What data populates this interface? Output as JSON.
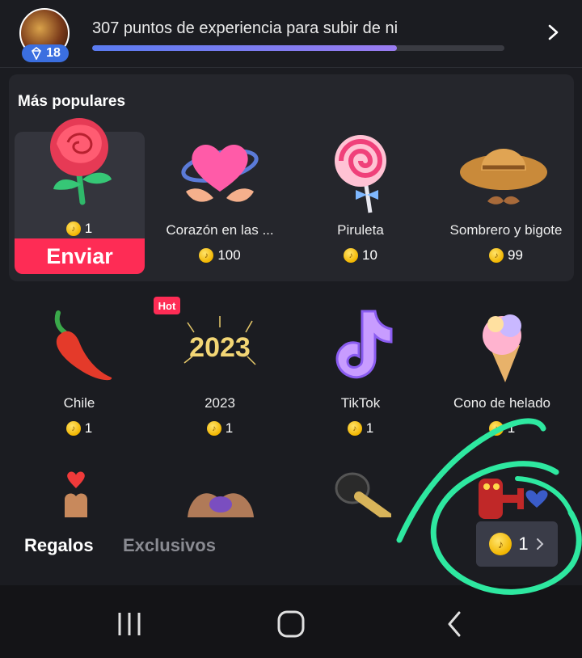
{
  "header": {
    "level": "18",
    "xp_text": "307 puntos de experiencia para subir de ni",
    "xp_progress": 0.74
  },
  "popular": {
    "title": "Más populares",
    "send_label": "Enviar",
    "items": [
      {
        "name": "",
        "price": "1",
        "icon": "rose-icon"
      },
      {
        "name": "Corazón en las ...",
        "price": "100",
        "icon": "heart-hands-icon"
      },
      {
        "name": "Piruleta",
        "price": "10",
        "icon": "lollipop-icon"
      },
      {
        "name": "Sombrero y bigote",
        "price": "99",
        "icon": "hat-mustache-icon"
      }
    ]
  },
  "gifts": [
    {
      "name": "Chile",
      "price": "1",
      "icon": "chili-icon"
    },
    {
      "name": "2023",
      "price": "1",
      "icon": "fireworks-2023-icon",
      "badge": "Hot"
    },
    {
      "name": "TikTok",
      "price": "1",
      "icon": "tiktok-icon"
    },
    {
      "name": "Cono de helado",
      "price": "1",
      "icon": "ice-cream-icon"
    }
  ],
  "tabs": {
    "active": "Regalos",
    "inactive": "Exclusivos"
  },
  "balance": "1",
  "colors": {
    "accent": "#fe2c55",
    "panel": "#25262c",
    "background": "#1b1c21"
  }
}
